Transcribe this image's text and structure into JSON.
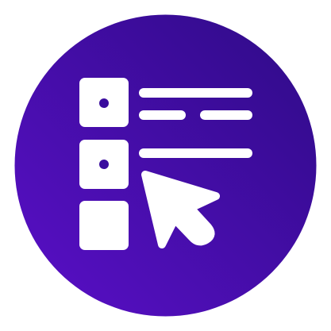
{
  "icon": {
    "name": "checklist-select-icon",
    "background_gradient": [
      "#2E0B86",
      "#5A0FC8"
    ],
    "foreground_color": "#FFFFFF",
    "items": [
      {
        "checkbox_state": "selected",
        "text_lines": 2
      },
      {
        "checkbox_state": "selected",
        "text_lines": 1
      },
      {
        "checkbox_state": "empty",
        "text_lines": 0
      }
    ],
    "cursor": "pointer-arrow"
  }
}
